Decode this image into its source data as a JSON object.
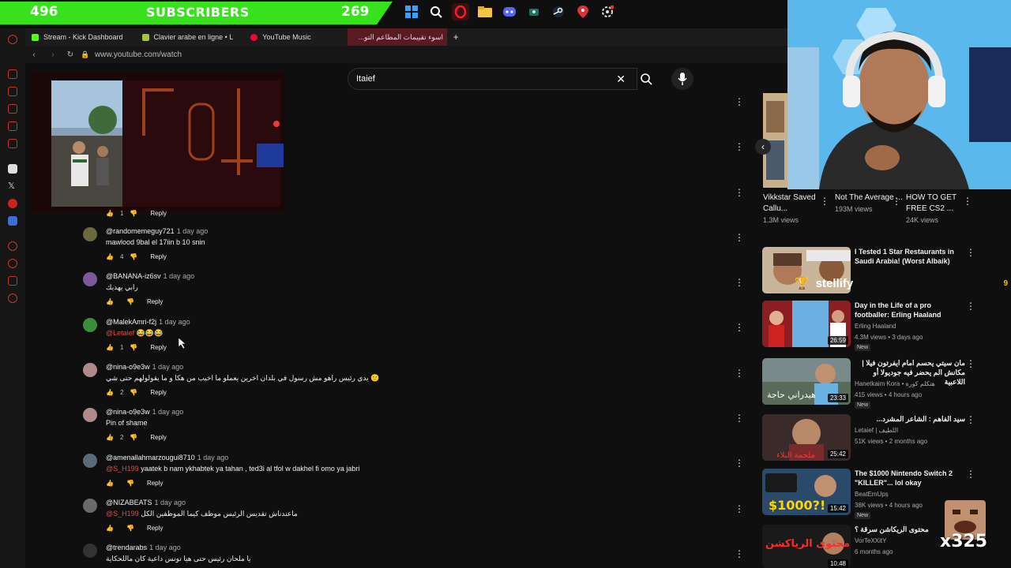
{
  "overlay": {
    "sub_left": "496",
    "sub_label": "SUBSCRIBERS",
    "sub_right": "269",
    "stellify": "stellify",
    "stellify_count": "9",
    "emote_text": "x325"
  },
  "taskbar": {
    "icons": [
      "windows-icon",
      "search-icon",
      "opera-icon",
      "folder-icon",
      "discord-icon",
      "app-icon",
      "steam-icon",
      "maps-icon",
      "settings-icon"
    ]
  },
  "tabs": [
    {
      "label": "Stream - Kick Dashboard",
      "color": "#53fc18"
    },
    {
      "label": "Clavier arabe en ligne • L",
      "color": "#a3c43b"
    },
    {
      "label": "YouTube Music",
      "color": "#ff0033"
    },
    {
      "label": "اسوء تقييمات المطاعم التو...",
      "color": "#ff0033",
      "active": true
    }
  ],
  "url": "www.youtube.com/watch",
  "search": {
    "value": "Itaief"
  },
  "comments": [
    {
      "user": "@randomemeguy721",
      "time": "1 day ago",
      "mention": "",
      "text": "mawlood 9bal el 17iin b 10 snin",
      "likes": "4",
      "reply": "Reply",
      "avatar": "#6a6a3a"
    },
    {
      "user": "@BANANA-iz6sv",
      "time": "1 day ago",
      "mention": "",
      "text": "رابي يهديك",
      "likes": "",
      "reply": "Reply",
      "avatar": "#7a5a9a"
    },
    {
      "user": "@MalekAmri-f2j",
      "time": "1 day ago",
      "mention": "@Letaief",
      "text": "😂😂😂",
      "likes": "1",
      "reply": "Reply",
      "avatar": "#3c8c3c"
    },
    {
      "user": "@nina-o9e3w",
      "time": "1 day ago",
      "mention": "",
      "text": "يدي رئيس راهو مش رسول في بلدان اخرين يعملو ما اخيب من هكا و ما يقولولهم حتى شي 🙂",
      "likes": "2",
      "reply": "Reply",
      "avatar": "#b08a8a"
    },
    {
      "user": "@nina-o9e3w",
      "time": "1 day ago",
      "mention": "",
      "text": "Pin of shame",
      "likes": "2",
      "reply": "Reply",
      "avatar": "#b08a8a"
    },
    {
      "user": "@amenallahmarzougui8710",
      "time": "1 day ago",
      "mention": "@S_H199",
      "text": "yaatek b nam ykhabtek ya tahan , ted3i al tfol w dakhel fi omo ya jabri",
      "likes": "",
      "reply": "Reply",
      "avatar": "#5a6a7a"
    },
    {
      "user": "@NIZABEATS",
      "time": "1 day ago",
      "mention": "@S_H199",
      "text": "ماعندناش تقديس الرئيس موظف كيما الموظفين الكل",
      "likes": "",
      "reply": "Reply",
      "avatar": "#6a6a6a"
    },
    {
      "user": "@trendarabs",
      "time": "1 day ago",
      "mention": "",
      "text": "يا ملحان رئيس حتى هيا تونس داعية كان ماللحكاية",
      "likes": "",
      "reply": "",
      "avatar": "#333333"
    }
  ],
  "prev_reply": "Reply",
  "prev_likes": "1",
  "shorts": [
    {
      "title": "Vikkstar Saved Callu...",
      "views": "1.3M views"
    },
    {
      "title": "Not The Average ...",
      "views": "193M views"
    },
    {
      "title": "HOW TO GET FREE CS2 ...",
      "views": "24K views"
    }
  ],
  "recs": [
    {
      "title": "I Tested 1 Star Restaurants in Saudi Arabia! (Worst Albaik)",
      "channel": "",
      "stats": "",
      "duration": "",
      "is_new": false,
      "new_label": ""
    },
    {
      "title": "Day in the Life of a pro footballer: Erling Haaland",
      "channel": "Erling Haaland",
      "stats": "4.3M views • 3 days ago",
      "duration": "26:59",
      "is_new": true,
      "new_label": "New"
    },
    {
      "title": "مان سيتي يحسم امام ايفرتون فيلا | مكانش الم يحضر فيه جوديولا أو اللاعبية",
      "channel": "Hanetkaim Kora • هتكلم كورة",
      "stats": "415 views • 4 hours ago",
      "duration": "23:33",
      "is_new": true,
      "new_label": "New"
    },
    {
      "title": "سيد الفاهم : الشاعر المشرد...",
      "channel": "Letaief | اللطيف",
      "stats": "51K views • 2 months ago",
      "duration": "25:42",
      "is_new": false,
      "new_label": ""
    },
    {
      "title": "The $1000 Nintendo Switch 2 \"KILLER\"... lol okay",
      "channel": "BeatEmUps",
      "stats": "38K views • 4 hours ago",
      "duration": "15:42",
      "is_new": true,
      "new_label": "New"
    },
    {
      "title": "محتوى الريكاشن سرقة ؟",
      "channel": "VorTeXXitY",
      "stats": "6 months ago",
      "duration": "10:48",
      "is_new": false,
      "new_label": ""
    }
  ],
  "thumb_texts": {
    "rec3": "هيدراني حاجة",
    "rec4": "ملحمة البلاء",
    "rec5": "$1000?!",
    "rec6": "محتوى الرياكشن"
  }
}
